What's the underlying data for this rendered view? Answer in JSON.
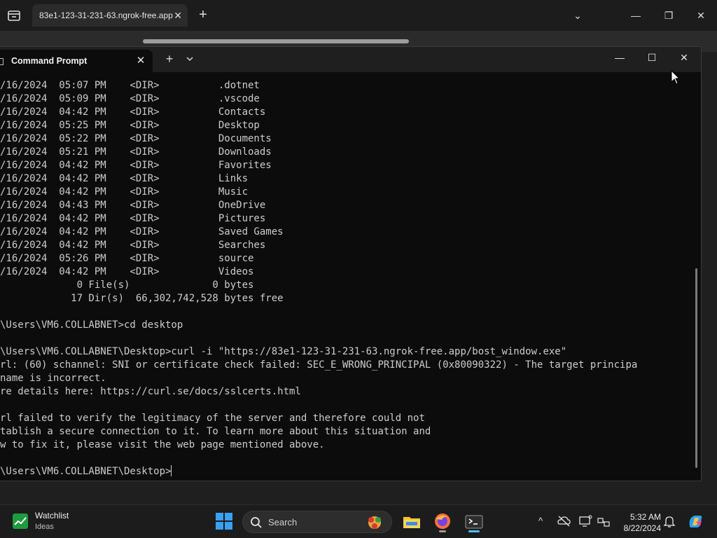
{
  "browser": {
    "tab_title": "83e1-123-31-231-63.ngrok-free.app",
    "tab_close": "✕",
    "new_tab": "+",
    "ctrl_dropdown": "⌄",
    "ctrl_minimize": "—",
    "ctrl_restore": "❐",
    "ctrl_close": "✕"
  },
  "terminal": {
    "tab_title": "Command Prompt",
    "tab_close": "✕",
    "new_tab": "+",
    "win_minimize": "—",
    "win_maximize": "☐",
    "win_close": "✕",
    "lines": [
      "/16/2024  05:07 PM    <DIR>          .dotnet",
      "/16/2024  05:09 PM    <DIR>          .vscode",
      "/16/2024  04:42 PM    <DIR>          Contacts",
      "/16/2024  05:25 PM    <DIR>          Desktop",
      "/16/2024  05:22 PM    <DIR>          Documents",
      "/16/2024  05:21 PM    <DIR>          Downloads",
      "/16/2024  04:42 PM    <DIR>          Favorites",
      "/16/2024  04:42 PM    <DIR>          Links",
      "/16/2024  04:42 PM    <DIR>          Music",
      "/16/2024  04:43 PM    <DIR>          OneDrive",
      "/16/2024  04:42 PM    <DIR>          Pictures",
      "/16/2024  04:42 PM    <DIR>          Saved Games",
      "/16/2024  04:42 PM    <DIR>          Searches",
      "/16/2024  05:26 PM    <DIR>          source",
      "/16/2024  04:42 PM    <DIR>          Videos",
      "             0 File(s)              0 bytes",
      "            17 Dir(s)  66,302,742,528 bytes free",
      "",
      "\\Users\\VM6.COLLABNET>cd desktop",
      "",
      "\\Users\\VM6.COLLABNET\\Desktop>curl -i \"https://83e1-123-31-231-63.ngrok-free.app/bost_window.exe\"",
      "rl: (60) schannel: SNI or certificate check failed: SEC_E_WRONG_PRINCIPAL (0x80090322) - The target principa",
      "name is incorrect.",
      "re details here: https://curl.se/docs/sslcerts.html",
      "",
      "rl failed to verify the legitimacy of the server and therefore could not",
      "tablish a secure connection to it. To learn more about this situation and",
      "w to fix it, please visit the web page mentioned above.",
      "",
      "\\Users\\VM6.COLLABNET\\Desktop>"
    ]
  },
  "taskbar": {
    "widget_title": "Watchlist",
    "widget_subtitle": "Ideas",
    "search_label": "Search",
    "tray_chevron": "^",
    "time": "5:32 AM",
    "date": "8/22/2024"
  },
  "colors": {
    "terminal_bg": "#0c0c0c",
    "terminal_text": "#cccccc",
    "taskbar_bg": "#1c1c1c",
    "accent": "#4cc2ff"
  }
}
